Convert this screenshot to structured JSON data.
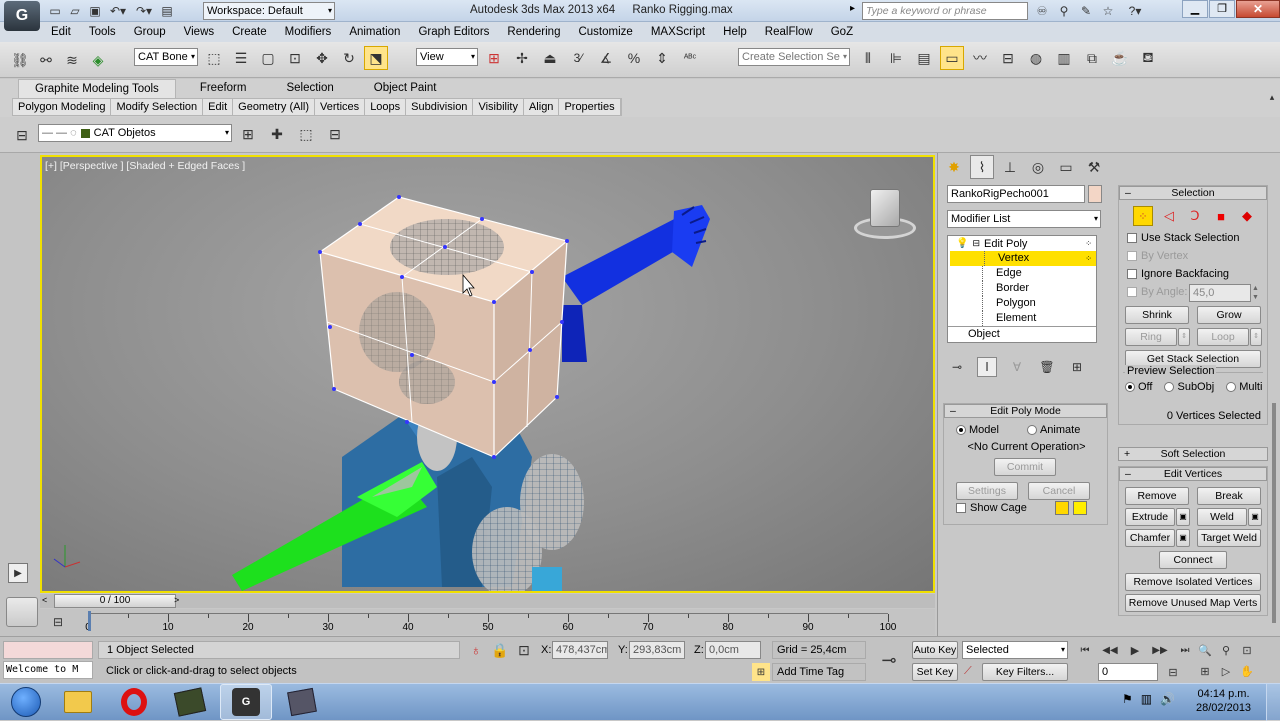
{
  "title_bar": {
    "workspace": "Workspace: Default",
    "app_title": "Autodesk 3ds Max  2013 x64",
    "file_name": "Ranko Rigging.max",
    "search_placeholder": "Type a keyword or phrase"
  },
  "menu": [
    "Edit",
    "Tools",
    "Group",
    "Views",
    "Create",
    "Modifiers",
    "Animation",
    "Graph Editors",
    "Rendering",
    "Customize",
    "MAXScript",
    "Help",
    "RealFlow",
    "GoZ"
  ],
  "main_toolbar": {
    "selection_filter": "CAT Bone",
    "ref_coord": "View",
    "named_selection_placeholder": "Create Selection Se"
  },
  "ribbon": {
    "tabs": [
      "Graphite Modeling Tools",
      "Freeform",
      "Selection",
      "Object Paint"
    ],
    "panels": [
      "Polygon Modeling",
      "Modify Selection",
      "Edit",
      "Geometry (All)",
      "Vertices",
      "Loops",
      "Subdivision",
      "Visibility",
      "Align",
      "Properties"
    ]
  },
  "layer_bar": {
    "layer": "CAT Objetos"
  },
  "viewport": {
    "label": "[+] [Perspective ] [Shaded + Edged Faces ]"
  },
  "command_panel": {
    "object_name": "RankoRigPecho001",
    "modifier_list": "Modifier List",
    "stack": {
      "modifier": "Edit Poly",
      "subobjects": [
        "Vertex",
        "Edge",
        "Border",
        "Polygon",
        "Element"
      ],
      "base": "Object",
      "active": "Vertex"
    },
    "edit_poly_mode": {
      "title": "Edit Poly Mode",
      "model": "Model",
      "animate": "Animate",
      "current_op": "<No Current Operation>",
      "commit": "Commit",
      "settings": "Settings",
      "cancel": "Cancel",
      "show_cage": "Show Cage"
    },
    "selection": {
      "title": "Selection",
      "use_stack": "Use Stack Selection",
      "by_vertex": "By Vertex",
      "ignore_backfacing": "Ignore Backfacing",
      "by_angle": "By Angle:",
      "angle_value": "45,0",
      "shrink": "Shrink",
      "grow": "Grow",
      "ring": "Ring",
      "loop": "Loop",
      "get_stack": "Get Stack Selection",
      "preview_title": "Preview Selection",
      "preview_options": [
        "Off",
        "SubObj",
        "Multi"
      ],
      "status": "0 Vertices Selected"
    },
    "soft_selection": {
      "title": "Soft Selection"
    },
    "edit_vertices": {
      "title": "Edit Vertices",
      "remove": "Remove",
      "break": "Break",
      "extrude": "Extrude",
      "weld": "Weld",
      "chamfer": "Chamfer",
      "target_weld": "Target Weld",
      "connect": "Connect",
      "remove_isolated": "Remove Isolated Vertices",
      "remove_unused": "Remove Unused Map Verts"
    }
  },
  "timeline": {
    "frame": "0 / 100",
    "ticks": [
      "0",
      "10",
      "20",
      "30",
      "40",
      "50",
      "60",
      "70",
      "80",
      "90",
      "100"
    ]
  },
  "status": {
    "selected": "1 Object Selected",
    "prompt": "Click or click-and-drag to select objects",
    "maxscript": "Welcome to M",
    "x_label": "X:",
    "x": "478,437cm",
    "y_label": "Y:",
    "y": "293,83cm",
    "z_label": "Z:",
    "z": "0,0cm",
    "grid": "Grid = 25,4cm",
    "add_time_tag": "Add Time Tag",
    "auto_key": "Auto Key",
    "set_key": "Set Key",
    "key_mode": "Selected",
    "key_filters": "Key Filters...",
    "frame_field": "0"
  },
  "taskbar": {
    "time": "04:14 p.m.",
    "date": "28/02/2013"
  },
  "colors": {
    "accent": "#ffd800",
    "viewport_border": "#f0e000",
    "win_bar": "#d9e7f5"
  }
}
